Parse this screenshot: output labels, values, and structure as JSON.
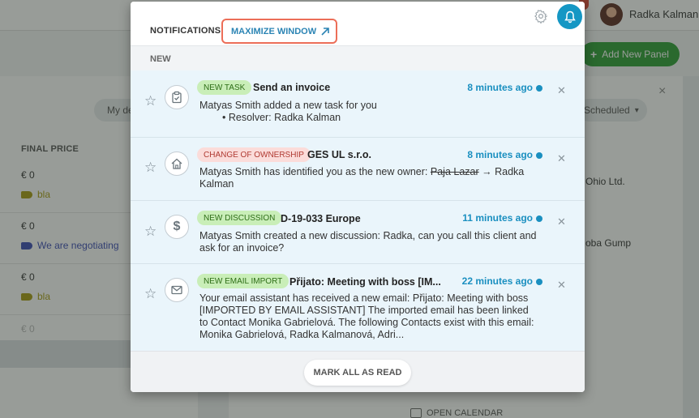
{
  "background": {
    "user_name": "Radka Kalman",
    "add_panel_label": "Add New Panel",
    "dashboard_pill": "My de",
    "column_header": "FINAL PRICE",
    "rows": [
      {
        "price": "€ 0",
        "tag": "bla",
        "tag_color": "#a89a10"
      },
      {
        "price": "€ 0",
        "tag": "We are negotiating",
        "tag_color": "#3b4bb5"
      },
      {
        "price": "€ 0",
        "tag": "bla",
        "tag_color": "#a89a10"
      },
      {
        "price": "€ 0",
        "tag": "",
        "tag_color": ""
      }
    ],
    "scheduled_label": "Scheduled",
    "text_a": "Ohio Ltd.",
    "text_b": "oba Gump",
    "open_calendar": "OPEN CALENDAR"
  },
  "popup": {
    "title": "NOTIFICATIONS",
    "maximize_label": "MAXIMIZE WINDOW",
    "section_label": "NEW",
    "accent_color": "#1a8fc0",
    "notifications": [
      {
        "icon": "clipboard-check-icon",
        "badge": "NEW TASK",
        "badge_style": "green",
        "title": "Send an invoice",
        "time": "8 minutes ago",
        "line1": "Matyas Smith added a new task for you",
        "bullet": "Resolver: Radka Kalman"
      },
      {
        "icon": "home-icon",
        "badge": "CHANGE OF OWNERSHIP",
        "badge_style": "pink",
        "title": "GES UL s.r.o.",
        "time": "8 minutes ago",
        "msg_before": "Matyas Smith has identified you as the new owner: ",
        "msg_strike": "Paja Lazar",
        "msg_after": " → Radka Kalman"
      },
      {
        "icon": "dollar-icon",
        "badge": "NEW DISCUSSION",
        "badge_style": "green",
        "title": "D-19-033 Europe",
        "time": "11 minutes ago",
        "message": "Matyas Smith created a new discussion: Radka, can you call this client and ask for an invoice?"
      },
      {
        "icon": "envelope-icon",
        "badge": "NEW EMAIL IMPORT",
        "badge_style": "green",
        "title": "Přijato: Meeting with boss [IM...",
        "time": "22 minutes ago",
        "message": "Your email assistant has received a new email: Přijato: Meeting with boss [IMPORTED BY EMAIL ASSISTANT] The imported email has been linked to Contact Monika Gabrielová. The following Contacts exist with this email: Monika Gabrielová, Radka Kalmanová, Adri..."
      }
    ],
    "mark_all_label": "MARK ALL AS READ"
  }
}
